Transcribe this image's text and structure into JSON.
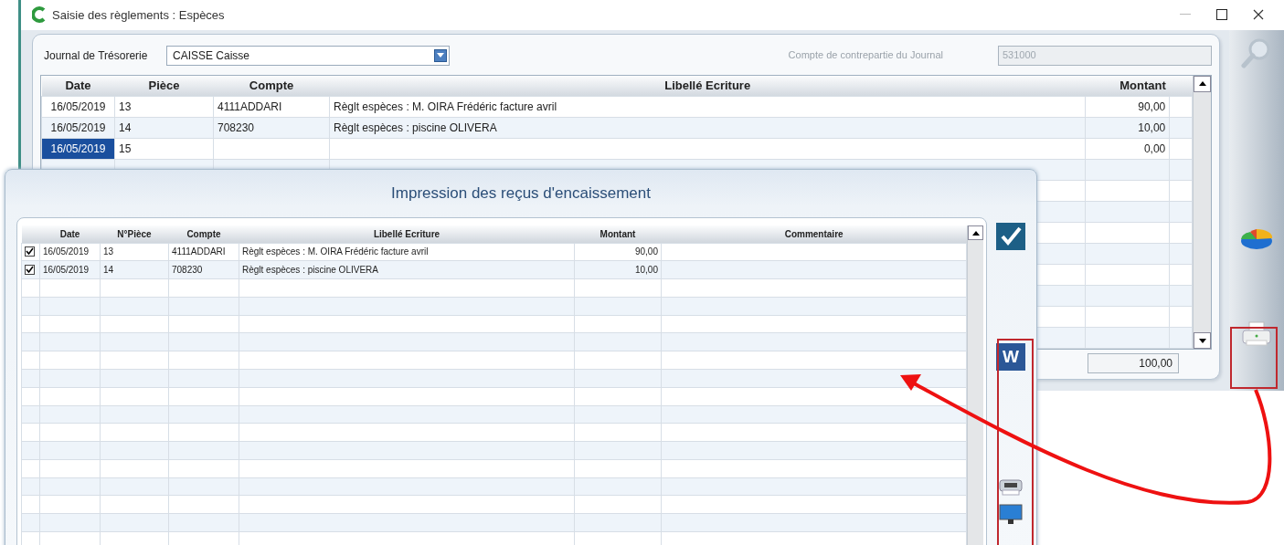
{
  "window": {
    "title": "Saisie des règlements : Espèces"
  },
  "journal": {
    "label": "Journal de Trésorerie",
    "value": "CAISSE Caisse"
  },
  "contrepartie": {
    "label": "Compte de contrepartie du Journal",
    "value": "531000"
  },
  "entries": {
    "columns": [
      "Date",
      "Pièce",
      "Compte",
      "Libellé Ecriture",
      "Montant"
    ],
    "rows": [
      {
        "selected": false,
        "cells": [
          "16/05/2019",
          "13",
          "4111ADDARI",
          "Règlt espèces : M. OIRA Frédéric facture avril",
          "90,00"
        ]
      },
      {
        "selected": false,
        "cells": [
          "16/05/2019",
          "14",
          "708230",
          "Règlt espèces : piscine OLIVERA",
          "10,00"
        ]
      },
      {
        "selected": true,
        "cells": [
          "16/05/2019",
          "15",
          "",
          "",
          "0,00"
        ]
      }
    ]
  },
  "total": "100,00",
  "dialog": {
    "title": "Impression des reçus d'encaissement",
    "columns": [
      "Date",
      "N°Pièce",
      "Compte",
      "Libellé Ecriture",
      "Montant",
      "Commentaire"
    ],
    "rows": [
      {
        "checked": true,
        "cells": [
          "16/05/2019",
          "13",
          "4111ADDARI",
          "Règlt espèces : M. OIRA Frédéric facture avril",
          "90,00",
          ""
        ]
      },
      {
        "checked": true,
        "cells": [
          "16/05/2019",
          "14",
          "708230",
          "Règlt espèces : piscine OLIVERA",
          "10,00",
          ""
        ]
      }
    ],
    "word_icon_letter": "W"
  }
}
